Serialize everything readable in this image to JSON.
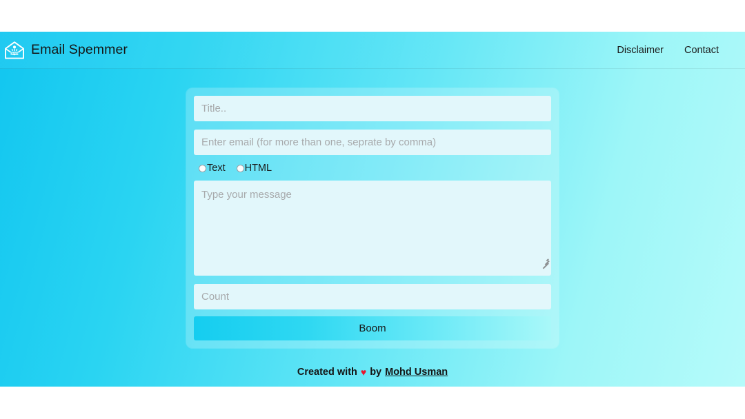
{
  "navbar": {
    "brand_label": "Email Spemmer",
    "brand_logo_icon": "envelope-spam-icon",
    "links": [
      {
        "label": "Disclaimer"
      },
      {
        "label": "Contact"
      }
    ]
  },
  "form": {
    "title_input": {
      "value": "",
      "placeholder": "Title.."
    },
    "email_input": {
      "value": "",
      "placeholder": "Enter email (for more than one, seprate by comma)"
    },
    "format_options": [
      {
        "label": "Text",
        "checked": false
      },
      {
        "label": "HTML",
        "checked": false
      }
    ],
    "message_textarea": {
      "value": "",
      "placeholder": "Type your message"
    },
    "count_input": {
      "value": "",
      "placeholder": "Count"
    },
    "submit_button": {
      "label": "Boom"
    }
  },
  "footer": {
    "prefix": "Created with",
    "heart": "♥",
    "middle": "by",
    "author": "Mohd Usman"
  },
  "colors": {
    "bg_gradient_start": "#12c6f0",
    "bg_gradient_end": "#b6fbfa",
    "field_bg": "#e2f7fb",
    "heart": "#e8162c",
    "text": "#141414"
  }
}
